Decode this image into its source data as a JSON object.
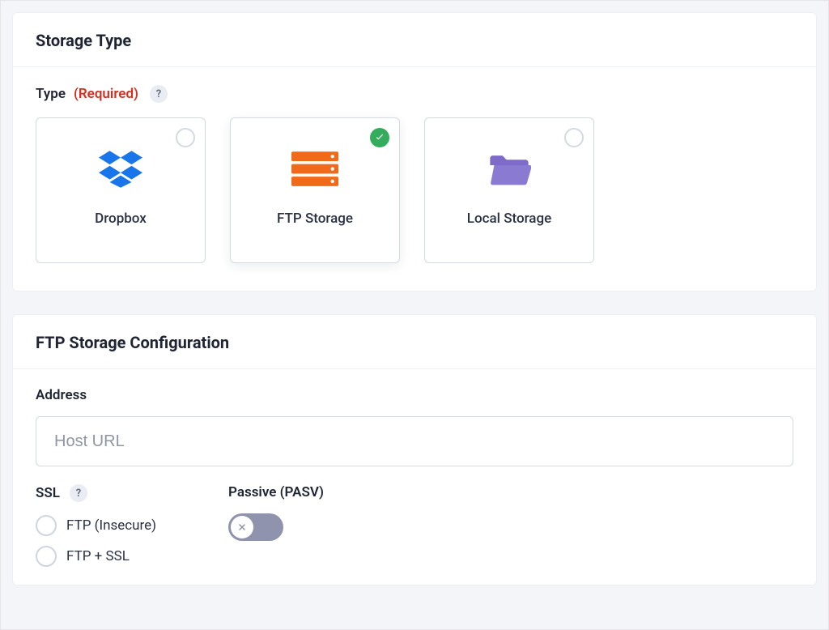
{
  "storage_type": {
    "title": "Storage Type",
    "type_label": "Type",
    "required_label": "(Required)",
    "help_glyph": "?",
    "cards": {
      "dropbox": {
        "label": "Dropbox",
        "icon": "dropbox-icon",
        "selected": false
      },
      "ftp": {
        "label": "FTP Storage",
        "icon": "server-icon",
        "selected": true
      },
      "local": {
        "label": "Local Storage",
        "icon": "folder-icon",
        "selected": false
      }
    }
  },
  "ftp_config": {
    "title": "FTP Storage Configuration",
    "address_label": "Address",
    "address_placeholder": "Host URL",
    "ssl": {
      "label": "SSL",
      "help_glyph": "?",
      "options": {
        "insecure": "FTP (Insecure)",
        "ssl": "FTP + SSL"
      }
    },
    "passive": {
      "label": "Passive (PASV)",
      "value": false
    }
  }
}
